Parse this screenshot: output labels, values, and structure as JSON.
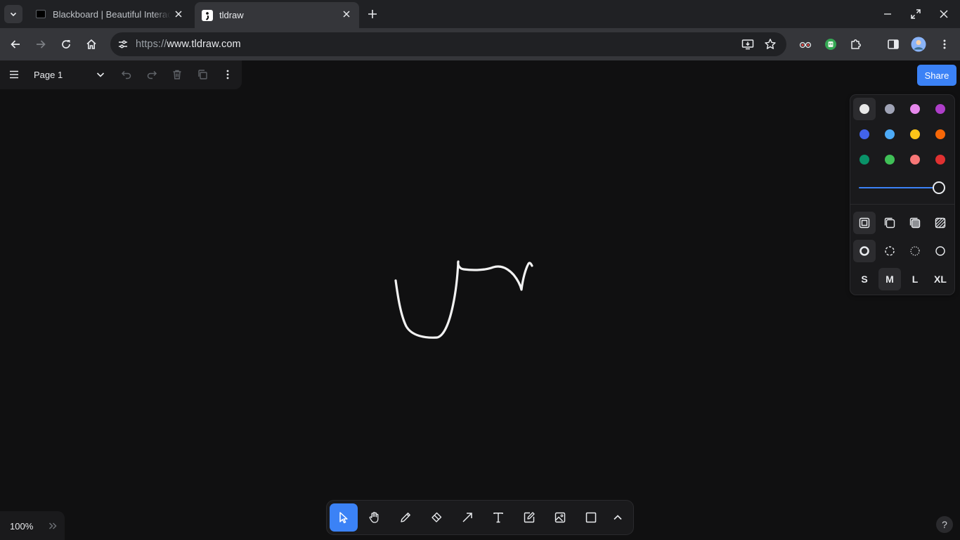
{
  "browser": {
    "tabs": [
      {
        "title": "Blackboard | Beautiful Interactive",
        "active": false
      },
      {
        "title": "tldraw",
        "active": true
      }
    ],
    "url": {
      "scheme": "https://",
      "host": "www.tldraw.com"
    }
  },
  "app": {
    "page_name": "Page 1",
    "share_label": "Share",
    "zoom_label": "100%",
    "help_label": "?",
    "colors": {
      "row1": [
        "#e8e8e8",
        "#9fa3b5",
        "#e688ec",
        "#ae3ec9"
      ],
      "row2": [
        "#4263eb",
        "#4dabf7",
        "#fcc419",
        "#f76707"
      ],
      "row3": [
        "#099268",
        "#40c057",
        "#f87777",
        "#e03131"
      ],
      "selected": "#e8e8e8"
    },
    "opacity": 1,
    "fill_options": [
      "none",
      "semi",
      "solid",
      "pattern"
    ],
    "dash_options": [
      "draw",
      "dashed",
      "dotted",
      "solid"
    ],
    "sizes": [
      "S",
      "M",
      "L",
      "XL"
    ],
    "selected_size": "M",
    "tools": [
      "select",
      "hand",
      "draw",
      "eraser",
      "arrow",
      "text",
      "note",
      "asset",
      "rectangle",
      "more"
    ],
    "selected_tool": "select",
    "accent_color": "#3b82f6"
  }
}
